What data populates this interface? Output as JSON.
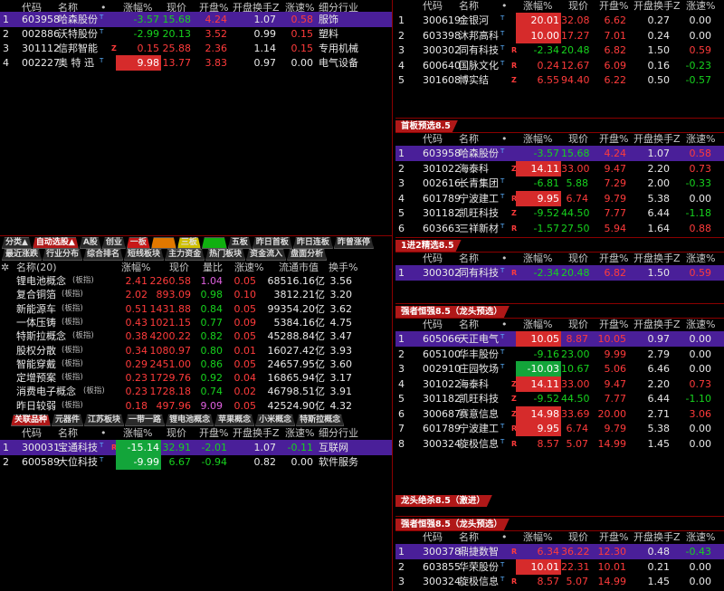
{
  "colors": {
    "up": "#ff3b3b",
    "down": "#17d31e",
    "flat": "#e8e8e8",
    "selected": "#4a1f99",
    "accent": "#b01818"
  },
  "top_left": {
    "header": {
      "code": "代码",
      "name": "名称",
      "dot": "•",
      "chg": "涨幅%",
      "price": "现价",
      "open": "开盘%",
      "open_turn": "开盘换手Z",
      "speed": "涨速%",
      "industry": "细分行业"
    },
    "rows": [
      {
        "idx": "1",
        "code": "603958",
        "name": "哈森股份",
        "flag": "T",
        "mark": "",
        "chg": "-3.57",
        "price": "15.68",
        "open": "4.24",
        "open_turn": "1.07",
        "speed": "0.58",
        "industry": "服饰"
      },
      {
        "idx": "2",
        "code": "002886",
        "name": "沃特股份",
        "flag": "T",
        "mark": "",
        "chg": "-2.99",
        "price": "20.13",
        "open": "3.52",
        "open_turn": "0.99",
        "speed": "0.15",
        "industry": "塑料"
      },
      {
        "idx": "3",
        "code": "301112",
        "name": "信邦智能",
        "flag": "",
        "mark": "Z",
        "chg": "0.15",
        "price": "25.88",
        "open": "2.36",
        "open_turn": "1.14",
        "speed": "0.15",
        "industry": "专用机械"
      },
      {
        "idx": "4",
        "code": "002227",
        "name": "奥 特 迅",
        "flag": "T",
        "mark": "",
        "chg": "9.98",
        "price": "13.77",
        "open": "3.83",
        "open_turn": "0.97",
        "speed": "0.00",
        "industry": "电气设备"
      }
    ]
  },
  "nav_tabs": [
    "分类▲",
    "自动选股▲",
    "A股",
    "创业",
    "一板",
    "",
    "三板",
    "",
    "五板",
    "昨日首板",
    "昨日连板",
    "昨曾涨停"
  ],
  "sector_tabs": [
    "最近涨跌",
    "行业分布",
    "综合排名",
    "短线板块",
    "主力资金",
    "热门板块",
    "资金流入",
    "盘面分析"
  ],
  "sector": {
    "header": {
      "name": "名称(20)",
      "chg": "涨幅%",
      "price": "现价",
      "ratio": "量比",
      "speed": "涨速%",
      "cap": "流通市值",
      "turn": "换手%"
    },
    "rows": [
      {
        "name": "锂电池概念",
        "tag": "(板指)",
        "chg": "2.41",
        "price": "2260.58",
        "ratio": "1.04",
        "speed": "0.05",
        "cap": "68516.16亿",
        "turn": "3.56"
      },
      {
        "name": "复合铜箔",
        "tag": "(板指)",
        "chg": "2.02",
        "price": "893.09",
        "ratio": "0.98",
        "speed": "0.10",
        "cap": "3812.21亿",
        "turn": "3.20"
      },
      {
        "name": "新能源车",
        "tag": "(板指)",
        "chg": "0.51",
        "price": "1431.88",
        "ratio": "0.84",
        "speed": "0.05",
        "cap": "99354.20亿",
        "turn": "3.62"
      },
      {
        "name": "一体压铸",
        "tag": "(板指)",
        "chg": "0.43",
        "price": "1021.15",
        "ratio": "0.77",
        "speed": "0.09",
        "cap": "5384.16亿",
        "turn": "4.75"
      },
      {
        "name": "特斯拉概念",
        "tag": "(板指)",
        "chg": "0.38",
        "price": "4200.22",
        "ratio": "0.82",
        "speed": "0.05",
        "cap": "45288.84亿",
        "turn": "3.47"
      },
      {
        "name": "股权分散",
        "tag": "(板指)",
        "chg": "0.34",
        "price": "1080.97",
        "ratio": "0.80",
        "speed": "0.01",
        "cap": "16027.42亿",
        "turn": "3.93"
      },
      {
        "name": "智能穿戴",
        "tag": "(板指)",
        "chg": "0.29",
        "price": "2451.00",
        "ratio": "0.86",
        "speed": "0.05",
        "cap": "24657.95亿",
        "turn": "3.60"
      },
      {
        "name": "定增预案",
        "tag": "(板指)",
        "chg": "0.23",
        "price": "1729.76",
        "ratio": "0.92",
        "speed": "0.04",
        "cap": "16865.94亿",
        "turn": "3.17"
      },
      {
        "name": "消费电子概念",
        "tag": "(板指)",
        "chg": "0.23",
        "price": "1728.18",
        "ratio": "0.74",
        "speed": "0.02",
        "cap": "46798.51亿",
        "turn": "3.91"
      },
      {
        "name": "昨日较弱",
        "tag": "(板指)",
        "chg": "0.18",
        "price": "497.96",
        "ratio": "9.09",
        "speed": "0.05",
        "cap": "42524.90亿",
        "turn": "4.32"
      }
    ]
  },
  "related_tabs": [
    "关联品种",
    "元器件",
    "江苏板块",
    "一带一路",
    "锂电池概念",
    "苹果概念",
    "小米概念",
    "特斯拉概念"
  ],
  "related": {
    "header": {
      "code": "代码",
      "name": "名称",
      "dot": "•",
      "chg": "涨幅%",
      "price": "现价",
      "open": "开盘%",
      "open_turn": "开盘换手Z",
      "speed": "涨速%",
      "industry": "细分行业"
    },
    "rows": [
      {
        "idx": "1",
        "code": "300031",
        "name": "宝通科技",
        "flag": "T",
        "mark": "R",
        "chg": "-15.14",
        "price": "32.91",
        "open": "-2.01",
        "open_turn": "1.07",
        "speed": "-0.11",
        "industry": "互联网"
      },
      {
        "idx": "2",
        "code": "600589",
        "name": "大位科技",
        "flag": "T",
        "mark": "",
        "chg": "-9.99",
        "price": "6.67",
        "open": "-0.94",
        "open_turn": "0.82",
        "speed": "0.00",
        "industry": "软件服务"
      }
    ]
  },
  "right_header": {
    "code": "代码",
    "name": "名称",
    "dot": "•",
    "chg": "涨幅%",
    "price": "现价",
    "open": "开盘%",
    "open_turn": "开盘换手Z",
    "speed": "涨速%"
  },
  "right_panels": [
    {
      "title": "",
      "rows": [
        {
          "idx": "1",
          "code": "300619",
          "name": "金银河",
          "flag": "T",
          "mark": "",
          "chg": "20.01",
          "price": "32.08",
          "open": "6.62",
          "open_turn": "0.27",
          "speed": "0.00"
        },
        {
          "idx": "2",
          "code": "603398",
          "name": "沐邦高科",
          "flag": "T",
          "mark": "",
          "chg": "10.00",
          "price": "17.27",
          "open": "7.01",
          "open_turn": "0.24",
          "speed": "0.00"
        },
        {
          "idx": "3",
          "code": "300302",
          "name": "同有科技",
          "flag": "T",
          "mark": "R",
          "chg": "-2.34",
          "price": "20.48",
          "open": "6.82",
          "open_turn": "1.50",
          "speed": "0.59"
        },
        {
          "idx": "4",
          "code": "600640",
          "name": "国脉文化",
          "flag": "T",
          "mark": "R",
          "chg": "0.24",
          "price": "12.67",
          "open": "6.09",
          "open_turn": "0.16",
          "speed": "-0.23"
        },
        {
          "idx": "5",
          "code": "301608",
          "name": "博实结",
          "flag": "",
          "mark": "Z",
          "chg": "6.55",
          "price": "94.40",
          "open": "6.22",
          "open_turn": "0.50",
          "speed": "-0.57"
        }
      ]
    },
    {
      "title": "首板预选8.5",
      "rows": [
        {
          "idx": "1",
          "code": "603958",
          "name": "哈森股份",
          "flag": "T",
          "mark": "",
          "chg": "-3.57",
          "price": "15.68",
          "open": "4.24",
          "open_turn": "1.07",
          "speed": "0.58"
        },
        {
          "idx": "2",
          "code": "301022",
          "name": "海泰科",
          "flag": "",
          "mark": "Z",
          "chg": "14.11",
          "price": "33.00",
          "open": "9.47",
          "open_turn": "2.20",
          "speed": "0.73"
        },
        {
          "idx": "3",
          "code": "002616",
          "name": "长青集团",
          "flag": "T",
          "mark": "",
          "chg": "-6.81",
          "price": "5.88",
          "open": "7.29",
          "open_turn": "2.00",
          "speed": "-0.33"
        },
        {
          "idx": "4",
          "code": "601789",
          "name": "宁波建工",
          "flag": "T",
          "mark": "R",
          "chg": "9.95",
          "price": "6.74",
          "open": "9.79",
          "open_turn": "5.38",
          "speed": "0.00"
        },
        {
          "idx": "5",
          "code": "301182",
          "name": "凯旺科技",
          "flag": "",
          "mark": "Z",
          "chg": "-9.52",
          "price": "44.50",
          "open": "7.77",
          "open_turn": "6.44",
          "speed": "-1.18"
        },
        {
          "idx": "6",
          "code": "603663",
          "name": "三祥新材",
          "flag": "T",
          "mark": "R",
          "chg": "-1.57",
          "price": "27.50",
          "open": "5.94",
          "open_turn": "1.64",
          "speed": "0.88"
        }
      ]
    },
    {
      "title": "1进2精选8.5",
      "rows": [
        {
          "idx": "1",
          "code": "300302",
          "name": "同有科技",
          "flag": "T",
          "mark": "R",
          "chg": "-2.34",
          "price": "20.48",
          "open": "6.82",
          "open_turn": "1.50",
          "speed": "0.59"
        }
      ]
    },
    {
      "title": "强者恒强8.5（龙头预选）",
      "rows": [
        {
          "idx": "1",
          "code": "605066",
          "name": "天正电气",
          "flag": "T",
          "mark": "",
          "chg": "10.05",
          "price": "8.87",
          "open": "10.05",
          "open_turn": "0.97",
          "speed": "0.00"
        },
        {
          "idx": "2",
          "code": "605100",
          "name": "华丰股份",
          "flag": "T",
          "mark": "",
          "chg": "-9.16",
          "price": "23.00",
          "open": "9.99",
          "open_turn": "2.79",
          "speed": "0.00"
        },
        {
          "idx": "3",
          "code": "002910",
          "name": "庄园牧场",
          "flag": "T",
          "mark": "",
          "chg": "-10.03",
          "price": "10.67",
          "open": "5.06",
          "open_turn": "6.46",
          "speed": "0.00"
        },
        {
          "idx": "4",
          "code": "301022",
          "name": "海泰科",
          "flag": "",
          "mark": "Z",
          "chg": "14.11",
          "price": "33.00",
          "open": "9.47",
          "open_turn": "2.20",
          "speed": "0.73"
        },
        {
          "idx": "5",
          "code": "301182",
          "name": "凯旺科技",
          "flag": "",
          "mark": "Z",
          "chg": "-9.52",
          "price": "44.50",
          "open": "7.77",
          "open_turn": "6.44",
          "speed": "-1.10"
        },
        {
          "idx": "6",
          "code": "300687",
          "name": "赛意信息",
          "flag": "",
          "mark": "Z",
          "chg": "14.98",
          "price": "33.69",
          "open": "20.00",
          "open_turn": "2.71",
          "speed": "3.06"
        },
        {
          "idx": "7",
          "code": "601789",
          "name": "宁波建工",
          "flag": "T",
          "mark": "R",
          "chg": "9.95",
          "price": "6.74",
          "open": "9.79",
          "open_turn": "5.38",
          "speed": "0.00"
        },
        {
          "idx": "8",
          "code": "300324",
          "name": "旋极信息",
          "flag": "T",
          "mark": "R",
          "chg": "8.57",
          "price": "5.07",
          "open": "14.99",
          "open_turn": "1.45",
          "speed": "0.00"
        }
      ]
    },
    {
      "title": "龙头绝杀8.5（激进）",
      "rows": []
    },
    {
      "title": "强者恒强8.5（龙头预选）",
      "rows": [
        {
          "idx": "1",
          "code": "300378",
          "name": "鼎捷数智",
          "flag": "",
          "mark": "R",
          "chg": "6.34",
          "price": "36.22",
          "open": "12.30",
          "open_turn": "0.48",
          "speed": "-0.43"
        },
        {
          "idx": "2",
          "code": "603855",
          "name": "华荣股份",
          "flag": "T",
          "mark": "",
          "chg": "10.01",
          "price": "22.31",
          "open": "10.01",
          "open_turn": "0.21",
          "speed": "0.00"
        },
        {
          "idx": "3",
          "code": "300324",
          "name": "旋极信息",
          "flag": "T",
          "mark": "R",
          "chg": "8.57",
          "price": "5.07",
          "open": "14.99",
          "open_turn": "1.45",
          "speed": "0.00"
        }
      ]
    }
  ]
}
